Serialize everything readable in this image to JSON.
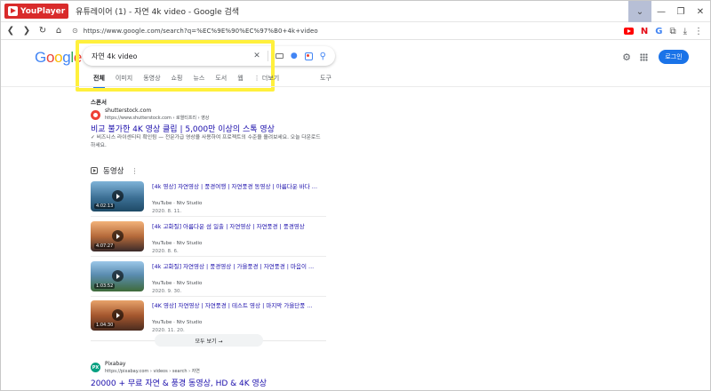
{
  "window": {
    "app_name": "YouPlayer",
    "title": "유튜레이어 (1) - 자연 4k video - Google 검색",
    "controls": [
      "⌄",
      "—",
      "❐",
      "✕"
    ]
  },
  "address_bar": {
    "url": "https://www.google.com/search?q=%EC%9E%90%EC%97%B0+4k+video"
  },
  "google": {
    "logo_letters": [
      "G",
      "o",
      "o",
      "g",
      "l",
      "e"
    ],
    "query": "자연 4k video",
    "login_label": "로그인"
  },
  "tabs": {
    "items": [
      "전체",
      "이미지",
      "동영상",
      "쇼핑",
      "뉴스",
      "도서",
      "웹",
      "⋮ 더보기"
    ],
    "active_index": 0,
    "tools_label": "도구"
  },
  "ad": {
    "sponsored_label": "스폰서",
    "site": "shutterstock.com",
    "url": "https://www.shutterstock.com › 로열티프리 › 영상",
    "title": "비교 불가한 4K 영상 클립 | 5,000만 이상의 스톡 영상",
    "desc": "✓ 비즈니스 라이센티티 확인됨 — 전문가급 영상을 사용하여 프로젝트의 수준을 올려보세요. 오늘 다운로드하세요."
  },
  "videos": {
    "header": "동영상",
    "items": [
      {
        "title": "[4k 영상] 자연영상 | 풍경여행 | 자연풍경 동영상 | 아름다운 바다 ...",
        "source": "YouTube · Ntv Studio",
        "date": "2020. 8. 11.",
        "duration": "4:02:13"
      },
      {
        "title": "[4k 고화질] 아름다운 섬 일출 | 자연영상 | 자연풍경 | 풍경영상",
        "source": "YouTube · Ntv Studio",
        "date": "2020. 8. 6.",
        "duration": "4:07:27"
      },
      {
        "title": "[4k 고화질] 자연영상 | 풍경영상 | 가을풍경 | 자연풍경 | 마음이 ...",
        "source": "YouTube · Ntv Studio",
        "date": "2020. 9. 30.",
        "duration": "1:03:52"
      },
      {
        "title": "[4K 영상] 자연영상 | 자연풍경 | 테스트 영상 | 마지막 가을단풍 ...",
        "source": "YouTube · Ntv Studio",
        "date": "2020. 11. 20.",
        "duration": "1:04:30"
      }
    ],
    "see_all": "모두 보기 →"
  },
  "next_result": {
    "site": "Pixabay",
    "favicon_text": "PX",
    "url": "https://pixabay.com › videos › search › 자연",
    "title": "20000 + 무료 자연 & 풍경 동영상, HD & 4K 영상"
  }
}
